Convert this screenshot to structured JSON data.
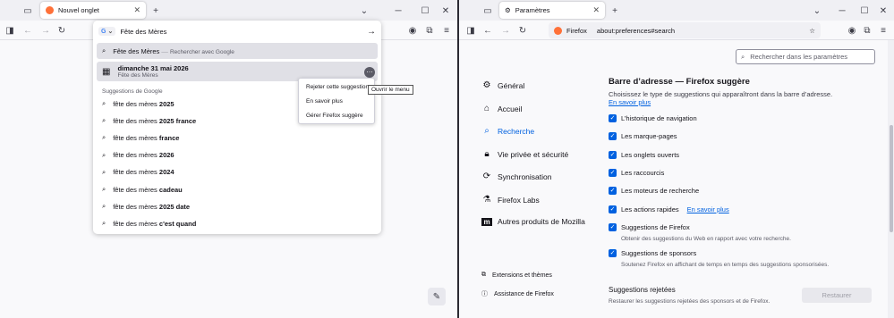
{
  "left": {
    "tab_title": "Nouvel onglet",
    "url_value": "Fête des Mères",
    "engine_badge": "G",
    "first_row": {
      "query": "Fête des Mères",
      "sep": " — ",
      "action": "Rechercher avec Google"
    },
    "event": {
      "title": "dimanche 31 mai 2026",
      "subtitle": "Fête des Mères"
    },
    "section": "Suggestions de Google",
    "suggestions": [
      {
        "prefix": "fête des mères ",
        "bold": "2025"
      },
      {
        "prefix": "fête des mères ",
        "bold": "2025 france"
      },
      {
        "prefix": "fête des mères ",
        "bold": "france"
      },
      {
        "prefix": "fête des mères ",
        "bold": "2026"
      },
      {
        "prefix": "fête des mères ",
        "bold": "2024"
      },
      {
        "prefix": "fête des mères ",
        "bold": "cadeau"
      },
      {
        "prefix": "fête des mères ",
        "bold": "2025 date"
      },
      {
        "prefix": "fête des mères ",
        "bold": "c'est quand"
      }
    ],
    "context_menu": [
      "Rejeter cette suggestion",
      "En savoir plus",
      "Gérer Firefox suggère"
    ],
    "tooltip": "Ouvrir le menu"
  },
  "right": {
    "tab_title": "Paramètres",
    "identity": "Firefox",
    "url": "about:preferences#search",
    "search_placeholder": "Rechercher dans les paramètres",
    "nav": [
      "Général",
      "Accueil",
      "Recherche",
      "Vie privée et sécurité",
      "Synchronisation",
      "Firefox Labs",
      "Autres produits de Mozilla"
    ],
    "nav_bottom": [
      "Extensions et thèmes",
      "Assistance de Firefox"
    ],
    "heading": "Barre d’adresse — Firefox suggère",
    "description": "Choisissez le type de suggestions qui apparaîtront dans la barre d’adresse.",
    "learn_more": "En savoir plus",
    "options": [
      "L’historique de navigation",
      "Les marque-pages",
      "Les onglets ouverts",
      "Les raccourcis",
      "Les moteurs de recherche",
      "Les actions rapides"
    ],
    "quick_actions_link": "En savoir plus",
    "firefox_suggestions": {
      "label": "Suggestions de Firefox",
      "sub": "Obtenir des suggestions du Web en rapport avec votre recherche."
    },
    "sponsor_suggestions": {
      "label": "Suggestions de sponsors",
      "sub": "Soutenez Firefox en affichant de temps en temps des suggestions sponsorisées."
    },
    "rejected": {
      "title": "Suggestions rejetées",
      "sub": "Restaurer les suggestions rejetées des sponsors et de Firefox.",
      "button": "Restaurer"
    }
  },
  "colors": {
    "accent": "#0061e0",
    "firefox_orange": "#ff7139"
  },
  "icons": [
    "tab-list-icon",
    "firefox-logo-icon",
    "close-icon",
    "plus-icon",
    "chevron-down-icon",
    "minimize-icon",
    "maximize-icon",
    "back-icon",
    "forward-icon",
    "reload-icon",
    "search-icon",
    "calendar-icon",
    "arrow-right-icon",
    "account-icon",
    "extensions-icon",
    "menu-icon",
    "gear-icon",
    "star-icon"
  ]
}
